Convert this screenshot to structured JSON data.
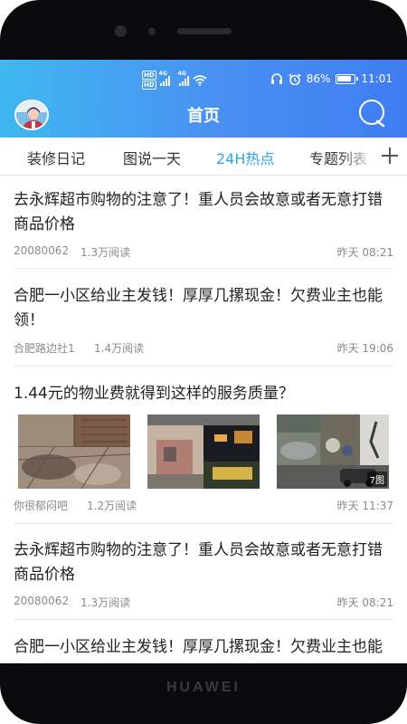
{
  "device": {
    "brand": "HUAWEI"
  },
  "status_bar": {
    "hd1": "HD",
    "hd2": "HD",
    "net1": "4G",
    "net2": "4G",
    "battery": "86%",
    "battery_level": 0.86,
    "time": "11:01",
    "icons": [
      "headphones-icon",
      "alarm-icon",
      "wifi-icon",
      "signal-icon",
      "battery-icon"
    ]
  },
  "header": {
    "title": "首页",
    "avatar_icon": "avatar",
    "search_icon": "search-icon"
  },
  "tabs": [
    {
      "label": "装修日记",
      "active": false
    },
    {
      "label": "图说一天",
      "active": false
    },
    {
      "label": "24H热点",
      "active": true
    },
    {
      "label": "专题列表",
      "active": false
    }
  ],
  "colors": {
    "accent": "#2fa5e6",
    "header_start": "#3fb8f0",
    "header_end": "#3f7df2"
  },
  "articles": [
    {
      "title": "去永辉超市购物的注意了！重人员会故意或者无意打错商品价格",
      "author": "20080062",
      "reads": "1.3万阅读",
      "time": "昨天 08:21"
    },
    {
      "title": "合肥一小区给业主发钱！厚厚几摞现金！欠费业主也能领！",
      "author": "合肥路边社1",
      "reads": "1.4万阅读",
      "time": "昨天 19:06"
    },
    {
      "title": "1.44元的物业费就得到这样的服务质量？",
      "author": "你很郁闷吧",
      "reads": "1.2万阅读",
      "time": "昨天 11:37",
      "image_count": "7图"
    },
    {
      "title": "去永辉超市购物的注意了！重人员会故意或者无意打错商品价格",
      "author": "20080062",
      "reads": "1.3万阅读",
      "time": "昨天 08:21"
    },
    {
      "title": "合肥一小区给业主发钱！厚厚几摞现金！欠费业主也能领！",
      "author": "",
      "reads": "",
      "time": ""
    }
  ]
}
